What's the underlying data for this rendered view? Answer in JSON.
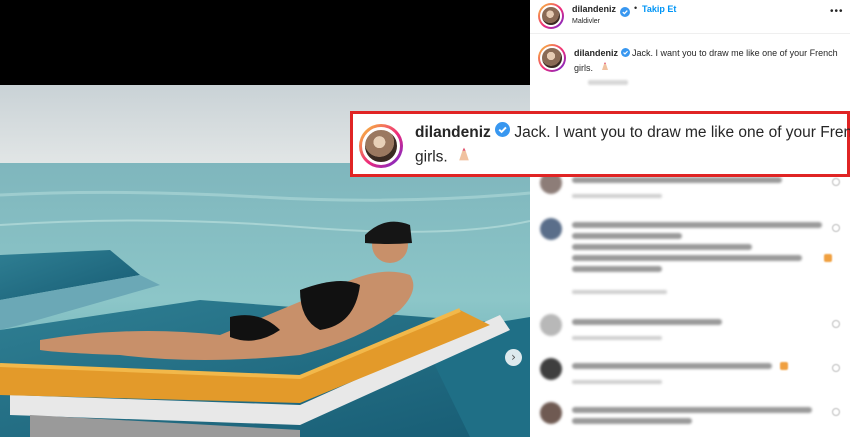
{
  "post": {
    "username": "dilandeniz",
    "follow_label": "Takip Et",
    "separator": "•",
    "location": "Maldivler",
    "more_label": "•••",
    "caption_text": "Jack. I want you to draw me like one of your French girls.",
    "carousel_next_label": "›"
  },
  "callout": {
    "username": "dilandeniz",
    "caption_line1": "Jack. I want you to draw me like one of your French",
    "caption_line2": "girls."
  },
  "colors": {
    "callout_border": "#e02424",
    "follow_blue": "#0095f6",
    "verified_blue": "#3897f0"
  },
  "icons": [
    "verified-badge-icon",
    "nail-polish-emoji-icon",
    "chevron-right-icon",
    "more-options-icon"
  ]
}
